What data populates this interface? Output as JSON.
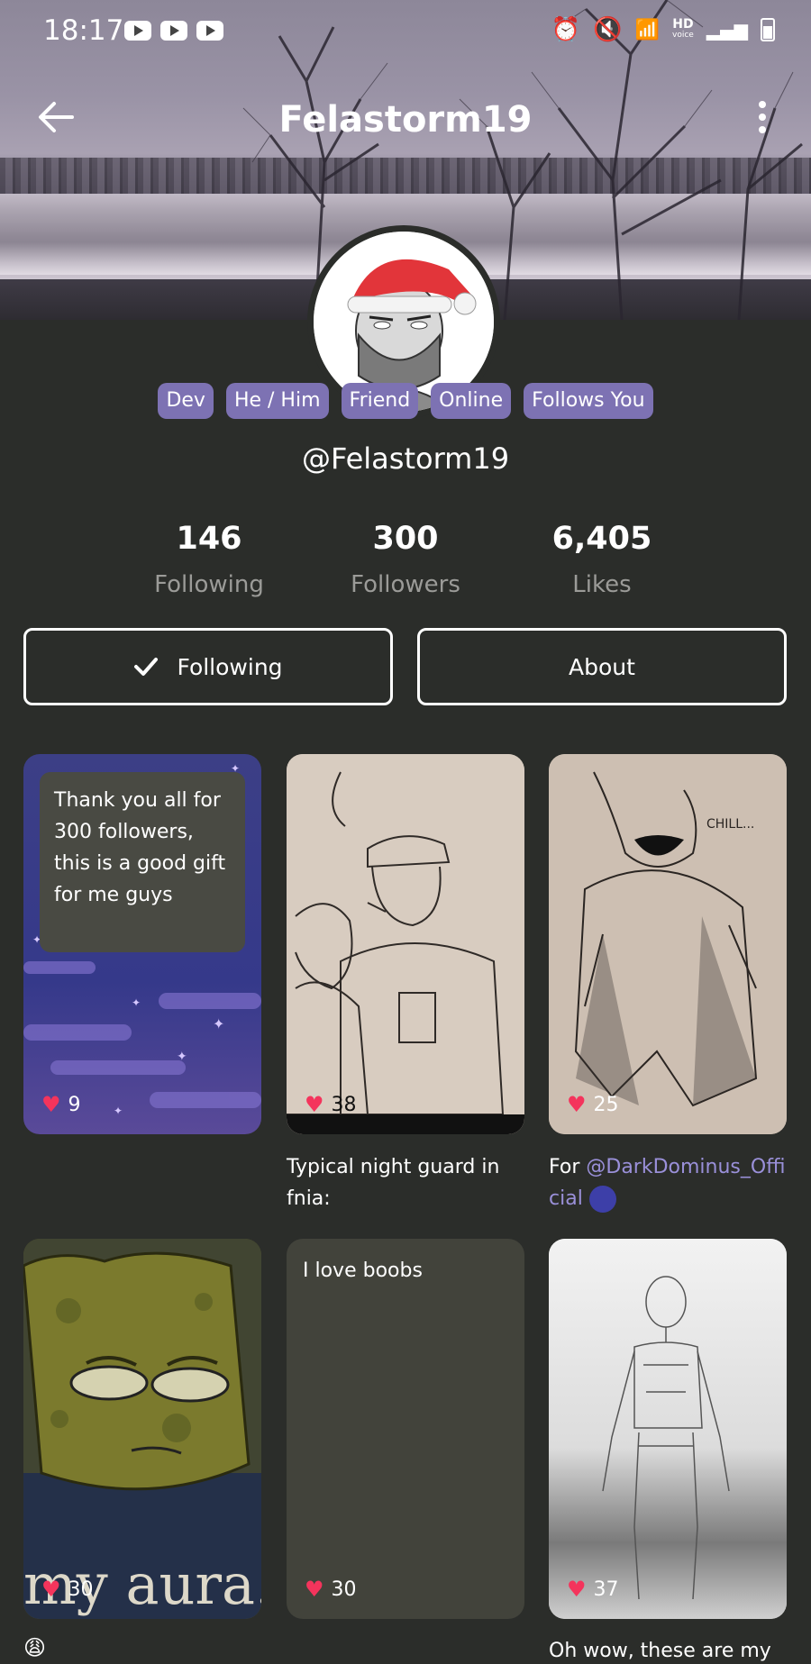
{
  "status_bar": {
    "time": "18:17"
  },
  "header": {
    "title": "Felastorm19"
  },
  "profile": {
    "badges": [
      "Dev",
      "He / Him",
      "Friend",
      "Online",
      "Follows You"
    ],
    "handle": "@Felastorm19",
    "stats": [
      {
        "value": "146",
        "label": "Following"
      },
      {
        "value": "300",
        "label": "Followers"
      },
      {
        "value": "6,405",
        "label": "Likes"
      }
    ],
    "following_button": "Following",
    "about_button": "About"
  },
  "posts": [
    {
      "text": "Thank you all for 300 followers, this is a good gift for me guys",
      "likes": "9"
    },
    {
      "likes": "38",
      "caption": "Typical night guard in fnia:"
    },
    {
      "likes": "25",
      "caption_prefix": "For ",
      "caption_mention": "@DarkDominus_Official",
      "image_text": "CHILL..."
    },
    {
      "likes": "30",
      "image_text": "my aura. go",
      "caption": "😩"
    },
    {
      "text": "I love boobs",
      "likes": "30"
    },
    {
      "likes": "37",
      "caption": "Oh wow, these are my"
    }
  ],
  "colors": {
    "background": "#2b2d2a",
    "badge": "#7d72b3",
    "heart": "#f4345c",
    "mention": "#9a90d9"
  }
}
